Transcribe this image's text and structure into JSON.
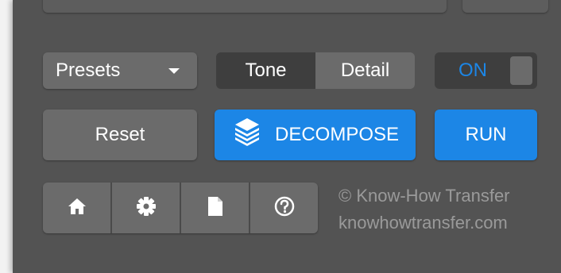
{
  "panel": {
    "presets": {
      "label": "Presets"
    },
    "segment": {
      "tone_label": "Tone",
      "detail_label": "Detail",
      "selected": "Tone"
    },
    "toggle": {
      "label": "ON",
      "state": "on"
    },
    "reset_label": "Reset",
    "decompose_label": "DECOMPOSE",
    "run_label": "RUN",
    "icons": [
      "home-icon",
      "gear-icon",
      "document-icon",
      "help-icon"
    ],
    "credit": {
      "line1": "© Know-How Transfer",
      "line2": "knowhowtransfer.com"
    }
  },
  "colors": {
    "panel_bg": "#535353",
    "button_grey": "#6b6b6b",
    "button_dark": "#3e3e3e",
    "accent_blue": "#1c86e6",
    "credit_text": "#9a9a9a"
  }
}
